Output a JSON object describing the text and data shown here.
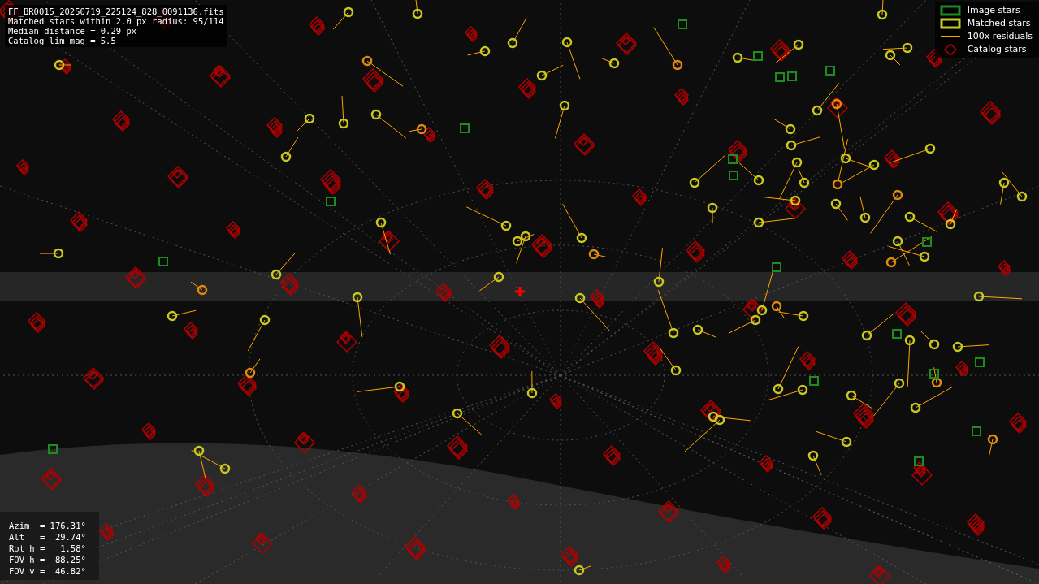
{
  "header_lines": [
    "FF_BR0015_20250719_225124_828_0091136.fits",
    "Matched stars within 2.0 px radius: 95/114",
    "Median distance = 0.29 px",
    "Catalog lim mag = 5.5"
  ],
  "legend": [
    {
      "kind": "box",
      "label": "Image stars",
      "color": "#1f8c1f"
    },
    {
      "kind": "box",
      "label": "Matched stars",
      "color": "#c8c81e"
    },
    {
      "kind": "line",
      "label": "100x residuals",
      "color": "#ffa500"
    },
    {
      "kind": "diamond",
      "label": "Catalog stars",
      "color": "#b00000"
    }
  ],
  "pointing": [
    "Azim  = 176.31°",
    "Alt   =  29.74°",
    "Rot h =   1.58°",
    "FOV h =  88.25°",
    "FOV v =  46.82°"
  ]
}
